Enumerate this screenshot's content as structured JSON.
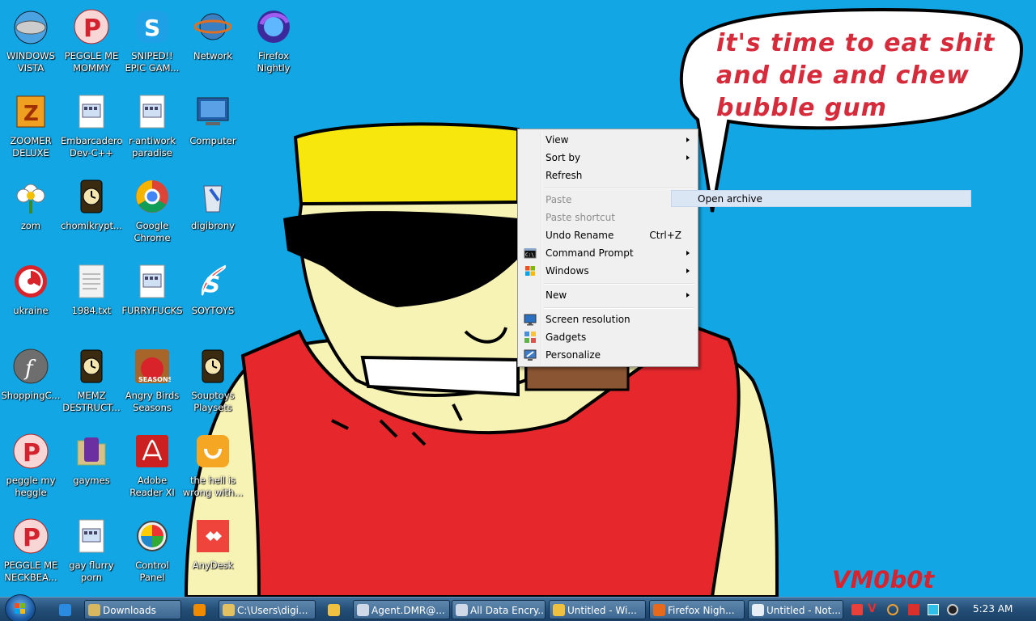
{
  "wallpaper": {
    "speech_bubble_text": "it's time to eat shit and die and chew bubble gum",
    "signature": "VM0b0t"
  },
  "desktop_icons": [
    {
      "label": "WINDOWS VISTA",
      "icon": "windows-vista-icon"
    },
    {
      "label": "PEGGLE ME MOMMY",
      "icon": "peggle-icon"
    },
    {
      "label": "SNIPED!! EPIC GAM...",
      "icon": "skype-icon"
    },
    {
      "label": "Network",
      "icon": "network-icon"
    },
    {
      "label": "Firefox Nightly",
      "icon": "firefox-nightly-icon"
    },
    {
      "label": "ZOOMER DELUXE",
      "icon": "zuma-icon"
    },
    {
      "label": "Embarcadero Dev-C++",
      "icon": "file-icon"
    },
    {
      "label": "r-antiwork paradise",
      "icon": "file-icon"
    },
    {
      "label": "Computer",
      "icon": "computer-icon"
    },
    {
      "label": "zom",
      "icon": "flower-icon"
    },
    {
      "label": "chomikrypt...",
      "icon": "clock-icon"
    },
    {
      "label": "Google Chrome",
      "icon": "chrome-icon"
    },
    {
      "label": "digibrony",
      "icon": "recycle-bin-icon"
    },
    {
      "label": "ukraine",
      "icon": "radiation-icon"
    },
    {
      "label": "1984.txt",
      "icon": "text-file-icon"
    },
    {
      "label": "FURRYFUCKS",
      "icon": "file-icon"
    },
    {
      "label": "SOYTOYS",
      "icon": "soytoys-icon"
    },
    {
      "label": "ShoppingC...",
      "icon": "flash-icon"
    },
    {
      "label": "MEMZ DESTRUCT...",
      "icon": "clock-icon"
    },
    {
      "label": "Angry Birds Seasons",
      "icon": "angry-birds-icon"
    },
    {
      "label": "Souptoys Playsets",
      "icon": "clock-icon"
    },
    {
      "label": "peggle my heggle",
      "icon": "peggle-icon"
    },
    {
      "label": "gaymes",
      "icon": "folder-icon"
    },
    {
      "label": "Adobe Reader XI",
      "icon": "adobe-reader-icon"
    },
    {
      "label": "the hell is wrong with...",
      "icon": "uc-browser-icon"
    },
    {
      "label": "PEGGLE ME NECKBEA...",
      "icon": "peggle-icon"
    },
    {
      "label": "gay flurry porn",
      "icon": "file-icon"
    },
    {
      "label": "Control Panel",
      "icon": "control-panel-icon"
    },
    {
      "label": "AnyDesk",
      "icon": "anydesk-icon"
    }
  ],
  "context_menu": {
    "items": [
      {
        "label": "View",
        "submenu": true,
        "disabled": false
      },
      {
        "label": "Sort by",
        "submenu": true,
        "disabled": false
      },
      {
        "label": "Refresh",
        "submenu": false,
        "disabled": false
      },
      {
        "label": "Paste",
        "submenu": false,
        "disabled": true
      },
      {
        "label": "Paste shortcut",
        "submenu": false,
        "disabled": true
      },
      {
        "label": "Undo Rename",
        "shortcut": "Ctrl+Z",
        "submenu": false,
        "disabled": false
      },
      {
        "label": "Command Prompt",
        "submenu": true,
        "disabled": false,
        "icon": "command-prompt-icon"
      },
      {
        "label": "Windows",
        "submenu": true,
        "disabled": false,
        "icon": "windows-flag-icon"
      },
      {
        "label": "New",
        "submenu": true,
        "disabled": false
      },
      {
        "label": "Screen resolution",
        "submenu": false,
        "disabled": false,
        "icon": "screen-resolution-icon"
      },
      {
        "label": "Gadgets",
        "submenu": false,
        "disabled": false,
        "icon": "gadgets-icon"
      },
      {
        "label": "Personalize",
        "submenu": false,
        "disabled": false,
        "icon": "personalize-icon"
      }
    ],
    "submenu_item": "Open archive"
  },
  "taskbar": {
    "buttons": [
      {
        "label": "",
        "icon": "internet-explorer-icon"
      },
      {
        "label": "Downloads",
        "icon": "folder-icon"
      },
      {
        "label": "",
        "icon": "media-player-icon"
      },
      {
        "label": "C:\\Users\\digi...",
        "icon": "explorer-icon"
      },
      {
        "label": "",
        "icon": "paint-icon"
      },
      {
        "label": "Agent.DMR@...",
        "icon": "window-icon"
      },
      {
        "label": "All Data Encry...",
        "icon": "window-icon"
      },
      {
        "label": "Untitled - Wi...",
        "icon": "paint-icon"
      },
      {
        "label": "Firefox Nigh...",
        "icon": "firefox-icon"
      },
      {
        "label": "Untitled - Not...",
        "icon": "notepad-icon"
      }
    ],
    "clock": "5:23 AM"
  },
  "colors": {
    "desktop_bg": "#12a6e4",
    "bubble_text": "#d62b3a",
    "menu_bg": "#f0f0f0",
    "disabled_text": "#8d8d8d"
  }
}
